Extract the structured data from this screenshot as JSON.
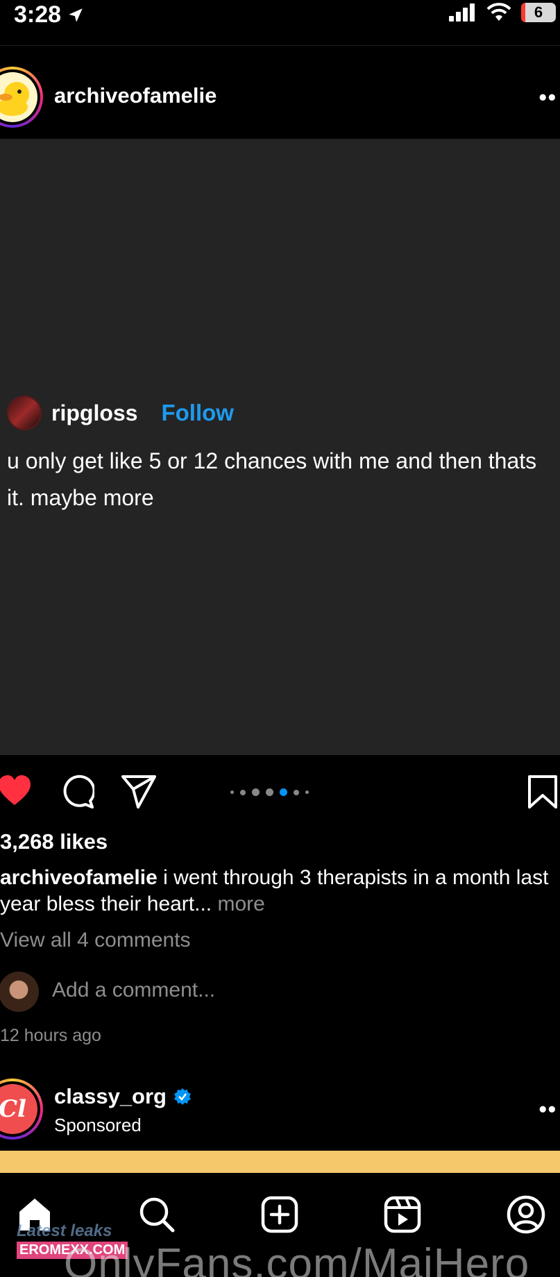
{
  "status_bar": {
    "time": "3:28",
    "battery_level": "6"
  },
  "post": {
    "username": "archiveofamelie",
    "media": {
      "tweet_username": "ripgloss",
      "tweet_follow": "Follow",
      "tweet_text": "u only get like 5 or 12 chances with me and then thats it. maybe more"
    },
    "carousel": {
      "total": 7,
      "active_index": 4
    },
    "likes": "3,268 likes",
    "caption_user": "archiveofamelie",
    "caption_text": " i went through 3 therapists in a month last year bless their heart...",
    "caption_more": "more",
    "view_comments": "View all 4 comments",
    "add_comment_placeholder": "Add a comment...",
    "time_ago": "12 hours ago"
  },
  "sponsored_post": {
    "username": "classy_org",
    "avatar_text": "Cl",
    "subtitle": "Sponsored"
  },
  "watermark": {
    "title": "Latest leaks",
    "site": "EROMEXX.COM",
    "overlay": "OnlyFans.com/MaiHero"
  },
  "colors": {
    "background": "#000000",
    "media_bg": "#242424",
    "follow_blue": "#1d9bf0",
    "like_red": "#ff3040",
    "muted_text": "#8e8e8e",
    "carousel_active": "#0095f6",
    "banner": "#f5c86b"
  },
  "icons": {
    "status": [
      "location-arrow-icon",
      "signal-icon",
      "wifi-icon",
      "battery-icon"
    ],
    "actions": [
      "heart-icon",
      "comment-icon",
      "share-icon",
      "bookmark-icon"
    ],
    "nav": [
      "home-icon",
      "search-icon",
      "create-icon",
      "reels-icon",
      "profile-icon"
    ]
  }
}
